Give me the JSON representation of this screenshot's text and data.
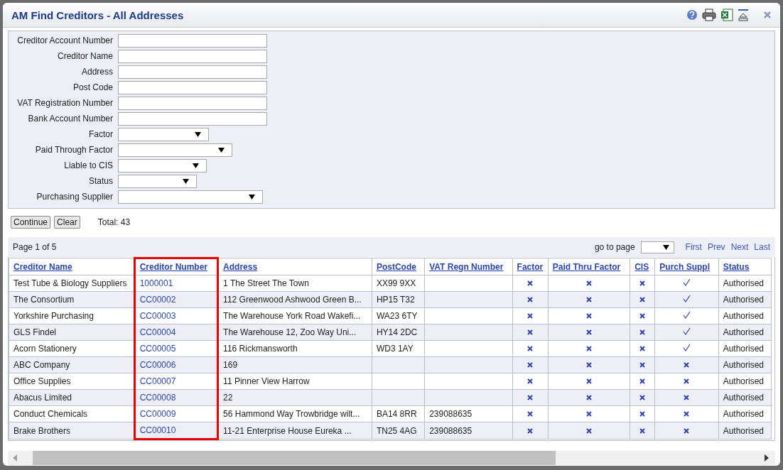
{
  "window": {
    "title": "AM Find Creditors - All Addresses"
  },
  "form": {
    "fields": [
      {
        "label": "Creditor Account Number",
        "kind": "text"
      },
      {
        "label": "Creditor Name",
        "kind": "text"
      },
      {
        "label": "Address",
        "kind": "text"
      },
      {
        "label": "Post Code",
        "kind": "text"
      },
      {
        "label": "VAT Registration Number",
        "kind": "text"
      },
      {
        "label": "Bank Account Number",
        "kind": "text"
      },
      {
        "label": "Factor",
        "kind": "select"
      },
      {
        "label": "Paid Through Factor",
        "kind": "select"
      },
      {
        "label": "Liable to CIS",
        "kind": "select"
      },
      {
        "label": "Status",
        "kind": "select"
      },
      {
        "label": "Purchasing Supplier",
        "kind": "select"
      }
    ]
  },
  "buttons": [
    "Continue",
    "Clear"
  ],
  "total": "Total: 43",
  "pager": {
    "page": "Page 1 of 5",
    "goto_label": "go to page",
    "links": [
      "First",
      "Prev",
      "Next",
      "Last"
    ]
  },
  "table": {
    "columns": [
      {
        "label": "Creditor Name",
        "highlighted": false
      },
      {
        "label": "Creditor Number",
        "highlighted": true
      },
      {
        "label": "Address",
        "highlighted": false
      },
      {
        "label": "PostCode",
        "highlighted": false
      },
      {
        "label": "VAT Regn Number",
        "highlighted": false
      },
      {
        "label": "Factor",
        "highlighted": false
      },
      {
        "label": "Paid Thru Factor",
        "highlighted": false
      },
      {
        "label": "CIS",
        "highlighted": false
      },
      {
        "label": "Purch Suppl",
        "highlighted": false
      },
      {
        "label": "Status",
        "highlighted": false
      }
    ],
    "rows": [
      {
        "name": "Test Tube & Biology Suppliers",
        "number": "1000001",
        "address": "1 The Street The Town",
        "postcode": "XX99 9XX",
        "vat": "",
        "factor": false,
        "paid_thru_factor": false,
        "cis": false,
        "purch_suppl": true,
        "status": "Authorised"
      },
      {
        "name": "The Consortium",
        "number": "CC00002",
        "address": "112 Greenwood Ashwood Green B...",
        "postcode": "HP15 T32",
        "vat": "",
        "factor": false,
        "paid_thru_factor": false,
        "cis": false,
        "purch_suppl": true,
        "status": "Authorised"
      },
      {
        "name": "Yorkshire Purchasing",
        "number": "CC00003",
        "address": "The Warehouse York Road Wakefi...",
        "postcode": "WA23 6TY",
        "vat": "",
        "factor": false,
        "paid_thru_factor": false,
        "cis": false,
        "purch_suppl": true,
        "status": "Authorised"
      },
      {
        "name": "GLS Findel",
        "number": "CC00004",
        "address": "The Warehouse 12, Zoo Way Uni...",
        "postcode": "HY14 2DC",
        "vat": "",
        "factor": false,
        "paid_thru_factor": false,
        "cis": false,
        "purch_suppl": true,
        "status": "Authorised"
      },
      {
        "name": "Acorn Stationery",
        "number": "CC00005",
        "address": "116 Rickmansworth",
        "postcode": "WD3 1AY",
        "vat": "",
        "factor": false,
        "paid_thru_factor": false,
        "cis": false,
        "purch_suppl": true,
        "status": "Authorised"
      },
      {
        "name": "ABC Company",
        "number": "CC00006",
        "address": "169",
        "postcode": "",
        "vat": "",
        "factor": false,
        "paid_thru_factor": false,
        "cis": false,
        "purch_suppl": false,
        "status": "Authorised"
      },
      {
        "name": "Office Supplies",
        "number": "CC00007",
        "address": "11 Pinner View Harrow",
        "postcode": "",
        "vat": "",
        "factor": false,
        "paid_thru_factor": false,
        "cis": false,
        "purch_suppl": false,
        "status": "Authorised"
      },
      {
        "name": "Abacus Limited",
        "number": "CC00008",
        "address": "22",
        "postcode": "",
        "vat": "",
        "factor": false,
        "paid_thru_factor": false,
        "cis": false,
        "purch_suppl": false,
        "status": "Authorised"
      },
      {
        "name": "Conduct Chemicals",
        "number": "CC00009",
        "address": "56 Hammond Way Trowbridge wilt...",
        "postcode": "BA14 8RR",
        "vat": "239088635",
        "factor": false,
        "paid_thru_factor": false,
        "cis": false,
        "purch_suppl": false,
        "status": "Authorised"
      },
      {
        "name": "Brake Brothers",
        "number": "CC00010",
        "address": "11-21 Enterprise House Eureka ...",
        "postcode": "TN25 4AG",
        "vat": "239088635",
        "factor": false,
        "paid_thru_factor": false,
        "cis": false,
        "purch_suppl": false,
        "status": "Authorised"
      }
    ]
  }
}
